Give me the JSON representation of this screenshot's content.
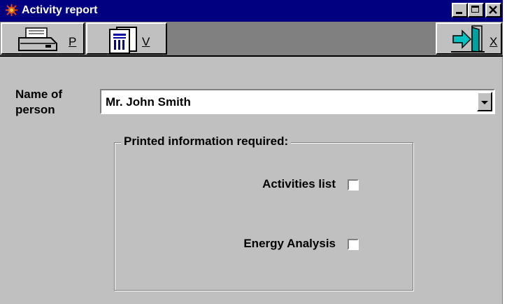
{
  "window": {
    "title": "Activity report",
    "controls": {
      "minimize": "_",
      "maximize": "□",
      "close": "×"
    }
  },
  "toolbar": {
    "print_hotkey": "P",
    "view_hotkey": "V",
    "exit_hotkey": "X"
  },
  "form": {
    "name_label": "Name of\nperson",
    "name_value": "Mr. John Smith",
    "group_title": "Printed information required:",
    "options": [
      {
        "label": "Activities list",
        "checked": false
      },
      {
        "label": "Energy Analysis",
        "checked": false
      }
    ]
  },
  "colors": {
    "title_bar": "#000080",
    "face": "#c0c0c0",
    "toolbar_bg": "#808080"
  }
}
